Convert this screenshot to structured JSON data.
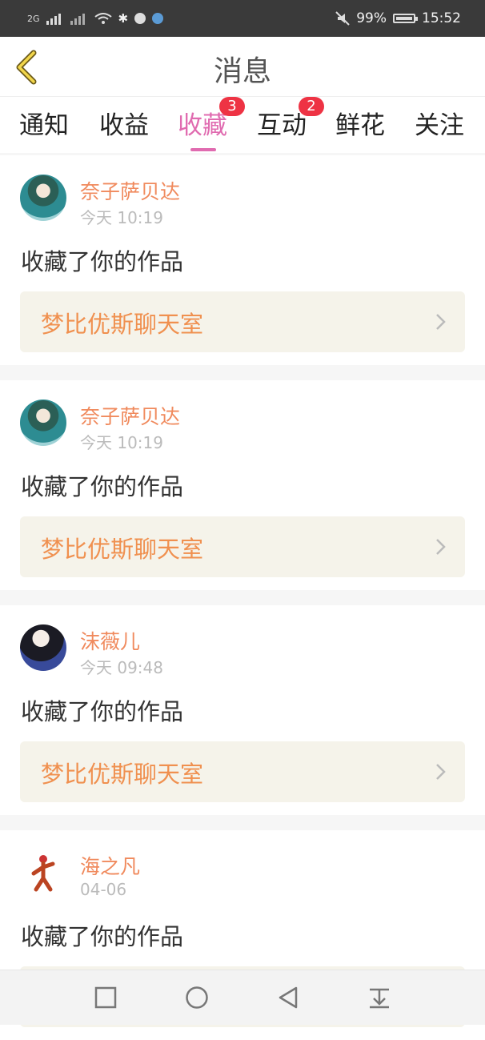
{
  "status_bar": {
    "signal_left": "2G",
    "battery": "99%",
    "time": "15:52"
  },
  "header": {
    "title": "消息"
  },
  "tabs": [
    {
      "label": "通知",
      "active": false
    },
    {
      "label": "收益",
      "active": false
    },
    {
      "label": "收藏",
      "active": true,
      "badge": "3"
    },
    {
      "label": "互动",
      "active": false,
      "badge": "2"
    },
    {
      "label": "鲜花",
      "active": false
    },
    {
      "label": "关注",
      "active": false
    }
  ],
  "items": [
    {
      "user": "奈子萨贝达",
      "time": "今天 10:19",
      "action": "收藏了你的作品",
      "work": "梦比优斯聊天室"
    },
    {
      "user": "奈子萨贝达",
      "time": "今天 10:19",
      "action": "收藏了你的作品",
      "work": "梦比优斯聊天室"
    },
    {
      "user": "沫薇儿",
      "time": "今天 09:48",
      "action": "收藏了你的作品",
      "work": "梦比优斯聊天室"
    },
    {
      "user": "海之凡",
      "time": "04-06",
      "action": "收藏了你的作品",
      "work": ""
    }
  ],
  "colors": {
    "accent": "#e06bb0",
    "name": "#f08a5d",
    "work": "#f0904f",
    "badge": "#ee3344"
  }
}
